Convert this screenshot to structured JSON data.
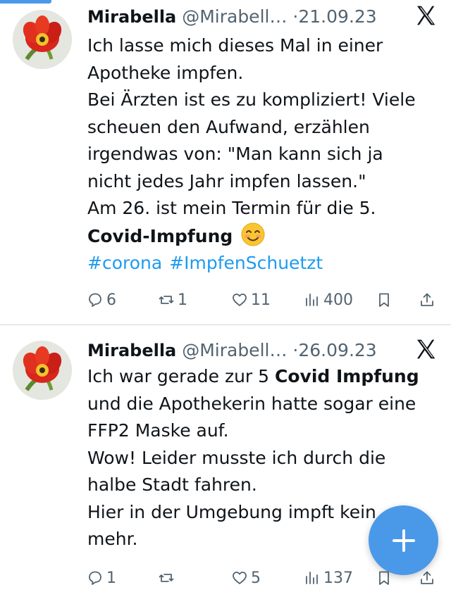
{
  "tweets": [
    {
      "display_name": "Mirabella",
      "handle": "@Mirabell…",
      "separator": "·",
      "date": "21.09.23",
      "lines": [
        "Ich lasse mich dieses Mal in einer",
        "Apotheke impfen.",
        "Bei Ärzten ist es zu kompliziert! Viele",
        "scheuen den Aufwand, erzählen",
        "irgendwas von: \"Man kann sich ja",
        "nicht jedes Jahr impfen lassen.\"",
        "Am 26. ist mein Termin für die 5."
      ],
      "bold_phrase": "Covid-Impfung",
      "hashtags": [
        "#corona",
        "#ImpfenSchuetzt"
      ],
      "stats": {
        "replies": "6",
        "reposts": "1",
        "likes": "11",
        "views": "400"
      }
    },
    {
      "display_name": "Mirabella",
      "handle": "@Mirabell…",
      "separator": "·",
      "date": "26.09.23",
      "line1_prefix": "Ich war gerade zur 5 ",
      "line1_bold": "Covid Impfung",
      "lines": [
        "und die Apothekerin hatte sogar eine",
        "FFP2 Maske auf.",
        "Wow! Leider musste ich durch die",
        "halbe Stadt fahren.",
        "Hier in der Umgebung impft kein",
        "mehr."
      ],
      "stats": {
        "replies": "1",
        "reposts": "",
        "likes": "5",
        "views": "137"
      }
    }
  ],
  "colors": {
    "link": "#1d9bf0",
    "muted": "#536471",
    "fab": "#4a99e9",
    "text": "#0f1419"
  },
  "icons": [
    "x-logo-icon",
    "reply-icon",
    "repost-icon",
    "like-icon",
    "views-icon",
    "bookmark-icon",
    "share-icon",
    "plus-icon",
    "smiling-face-emoji"
  ]
}
